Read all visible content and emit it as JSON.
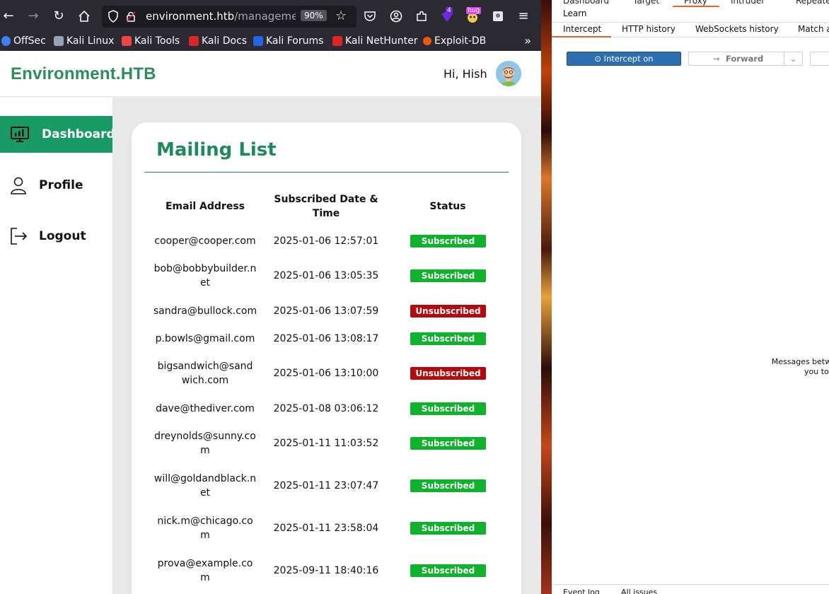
{
  "browser": {
    "url_host": "environment.htb",
    "url_path": "/management/dashboard",
    "zoom": "90%",
    "ext_badge_count": "4",
    "ext_badge_label": "bug",
    "bookmarks": [
      {
        "label": "OffSec",
        "color": "#3b82f6"
      },
      {
        "label": "Kali Linux",
        "color": "#cbd5e1"
      },
      {
        "label": "Kali Tools",
        "color": "#ef4444"
      },
      {
        "label": "Kali Docs",
        "color": "#dc2626"
      },
      {
        "label": "Kali Forums",
        "color": "#2563eb"
      },
      {
        "label": "Kali NetHunter",
        "color": "#dc2626"
      },
      {
        "label": "Exploit-DB",
        "color": "#ea580c"
      }
    ]
  },
  "app": {
    "brand": "Environment.HTB",
    "greeting": "Hi, Hish",
    "nav": [
      {
        "label": "Dashboard",
        "active": true
      },
      {
        "label": "Profile",
        "active": false
      },
      {
        "label": "Logout",
        "active": false
      }
    ],
    "mailing_list": {
      "title": "Mailing List",
      "headers": {
        "email": "Email Address",
        "date_line1": "Subscribed Date &",
        "date_line2": "Time",
        "status": "Status"
      },
      "rows": [
        {
          "email": [
            "cooper@cooper.com"
          ],
          "date": "2025-01-06 12:57:01",
          "status": "Subscribed"
        },
        {
          "email": [
            "bob@bobbybuilder.n",
            "et"
          ],
          "date": "2025-01-06 13:05:35",
          "status": "Subscribed"
        },
        {
          "email": [
            "sandra@bullock.com"
          ],
          "date": "2025-01-06 13:07:59",
          "status": "Unsubscribed"
        },
        {
          "email": [
            "p.bowls@gmail.com"
          ],
          "date": "2025-01-06 13:08:17",
          "status": "Subscribed"
        },
        {
          "email": [
            "bigsandwich@sand",
            "wich.com"
          ],
          "date": "2025-01-06 13:10:00",
          "status": "Unsubscribed"
        },
        {
          "email": [
            "dave@thediver.com"
          ],
          "date": "2025-01-08 03:06:12",
          "status": "Subscribed"
        },
        {
          "email": [
            "dreynolds@sunny.co",
            "m"
          ],
          "date": "2025-01-11 11:03:52",
          "status": "Subscribed"
        },
        {
          "email": [
            "will@goldandblack.n",
            "et"
          ],
          "date": "2025-01-11 23:07:47",
          "status": "Subscribed"
        },
        {
          "email": [
            "nick.m@chicago.co",
            "m"
          ],
          "date": "2025-01-11 23:58:04",
          "status": "Subscribed"
        },
        {
          "email": [
            "prova@example.co",
            "m"
          ],
          "date": "2025-09-11 18:40:16",
          "status": "Subscribed"
        }
      ]
    }
  },
  "burp": {
    "top_tabs": [
      "Dashboard",
      "Target",
      "Proxy",
      "Intruder",
      "Repeater"
    ],
    "learn": "Learn",
    "sub_tabs": [
      "Intercept",
      "HTTP history",
      "WebSockets history",
      "Match a"
    ],
    "intercept_button": "Intercept on",
    "forward_button": "Forward",
    "message_line1": "Messages betwe",
    "message_line2": "you to a",
    "bottom_tabs": [
      "Event log",
      "All issues"
    ]
  },
  "colors": {
    "brand_green": "#2a8f5a",
    "active_nav": "#179a66",
    "subscribed": "#0fb22b",
    "unsubscribed": "#b5080d",
    "burp_accent": "#e8622a",
    "burp_blue": "#2d6db0"
  }
}
